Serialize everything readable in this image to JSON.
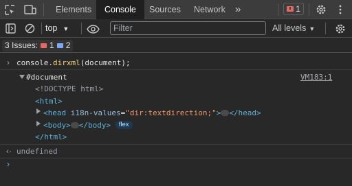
{
  "tabs": {
    "items": [
      {
        "label": "Elements"
      },
      {
        "label": "Console"
      },
      {
        "label": "Sources"
      },
      {
        "label": "Network"
      }
    ],
    "more": "»",
    "error_count": "1"
  },
  "toolbar": {
    "context": "top",
    "filter_placeholder": "Filter",
    "levels": "All levels"
  },
  "issues": {
    "label": "3 Issues:",
    "errors": "1",
    "info": "2"
  },
  "console": {
    "command": {
      "prefix": "console.",
      "method": "dirxml",
      "args": "(document);"
    },
    "source_link": "VM183:1",
    "document_label": "#document",
    "doctype": "<!DOCTYPE html>",
    "html_open": "<html>",
    "head_open_tag": "<head",
    "head_attr_name": "i18n-values",
    "head_attr_value": "\"dir:textdirection;\"",
    "head_close": "</head>",
    "body_open": "<body>",
    "body_close": "</body>",
    "flex_badge": "flex",
    "html_close": "</html>",
    "result": "undefined"
  },
  "colors": {
    "tag": "#5db0d7",
    "attr_name": "#9bbbdc",
    "attr_value": "#f29766",
    "error_red": "#e46962",
    "info_blue": "#7cacf8"
  }
}
